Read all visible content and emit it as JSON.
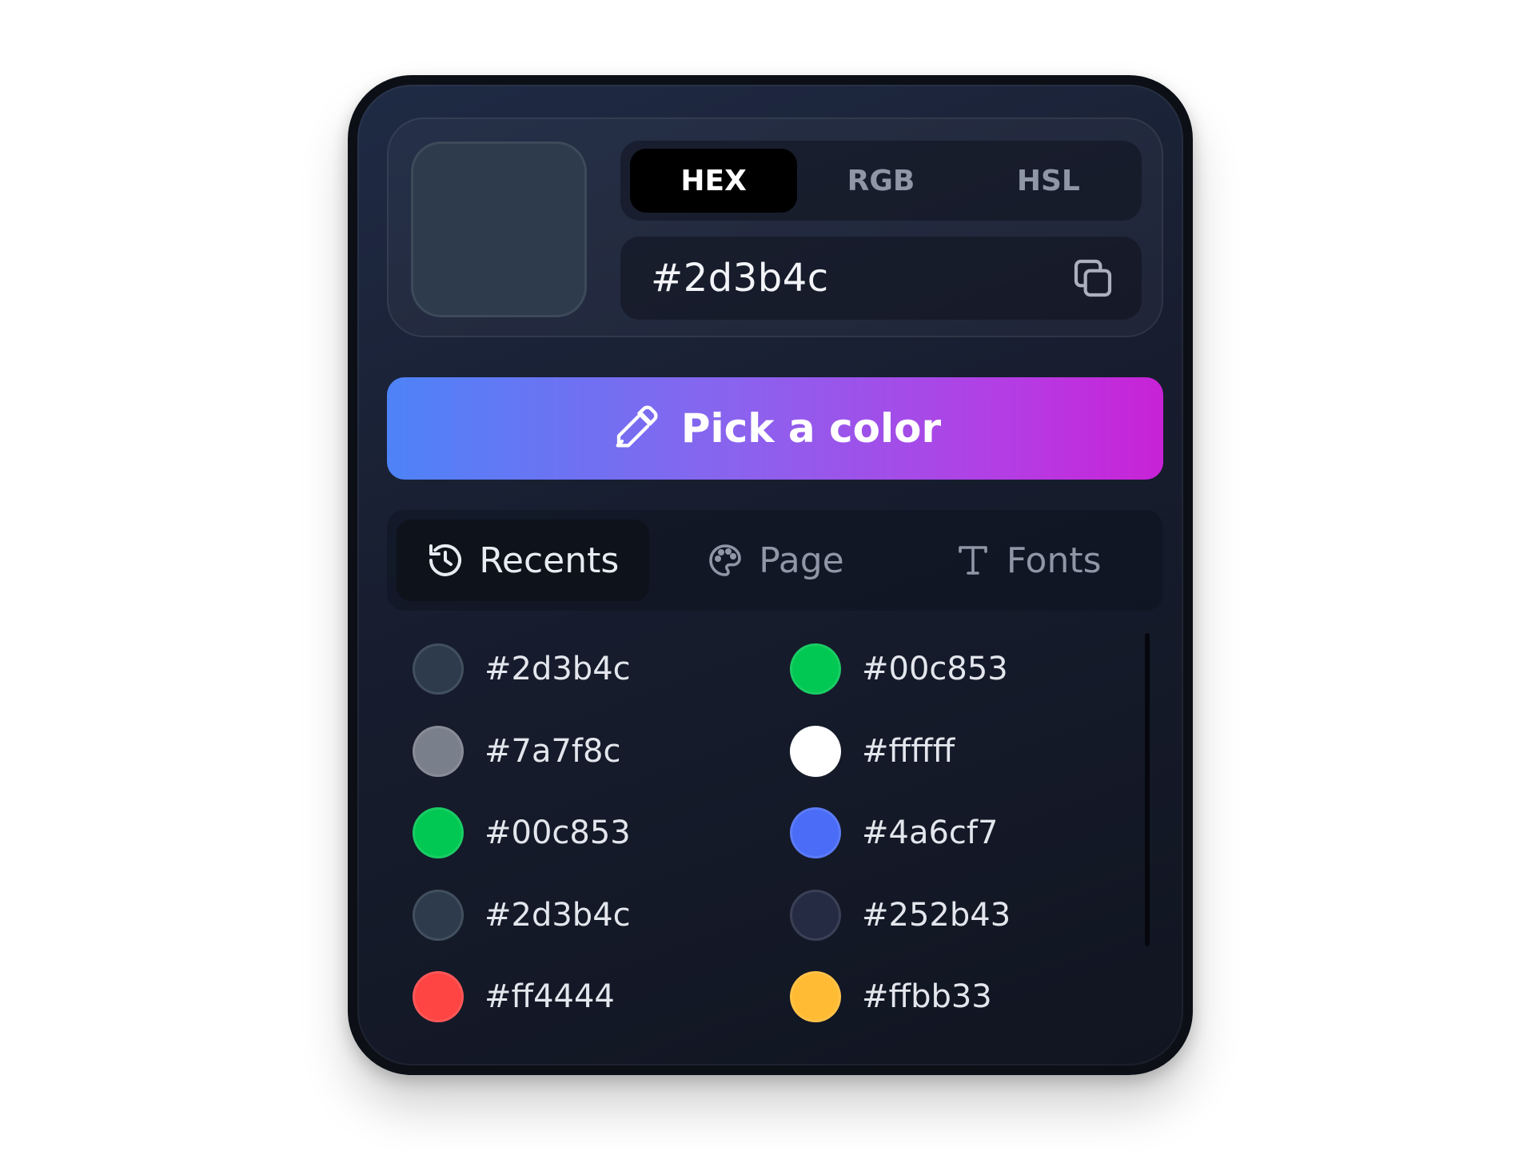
{
  "current_color": {
    "hex": "#2d3b4c"
  },
  "format_tabs": [
    {
      "label": "HEX",
      "active": true
    },
    {
      "label": "RGB",
      "active": false
    },
    {
      "label": "HSL",
      "active": false
    }
  ],
  "value_field": {
    "value": "#2d3b4c",
    "copy_icon": "copy-icon"
  },
  "pick_button": {
    "label": "Pick a color",
    "icon": "eyedropper-icon",
    "gradient": [
      "#4e83f7",
      "#8a63ee",
      "#b43de4",
      "#c822d6"
    ]
  },
  "source_tabs": [
    {
      "label": "Recents",
      "icon": "history-icon",
      "active": true
    },
    {
      "label": "Page",
      "icon": "palette-icon",
      "active": false
    },
    {
      "label": "Fonts",
      "icon": "type-icon",
      "active": false
    }
  ],
  "recents": [
    {
      "label": "#2d3b4c",
      "color": "#2d3b4c"
    },
    {
      "label": "#00c853",
      "color": "#00c853"
    },
    {
      "label": "#7a7f8c",
      "color": "#7a7f8c"
    },
    {
      "label": "#ffffff",
      "color": "#ffffff"
    },
    {
      "label": "#00c853",
      "color": "#00c853"
    },
    {
      "label": "#4a6cf7",
      "color": "#4a6cf7"
    },
    {
      "label": "#2d3b4c",
      "color": "#2d3b4c"
    },
    {
      "label": "#252b43",
      "color": "#252b43"
    },
    {
      "label": "#ff4444",
      "color": "#ff4444"
    },
    {
      "label": "#ffbb33",
      "color": "#ffbb33"
    }
  ]
}
